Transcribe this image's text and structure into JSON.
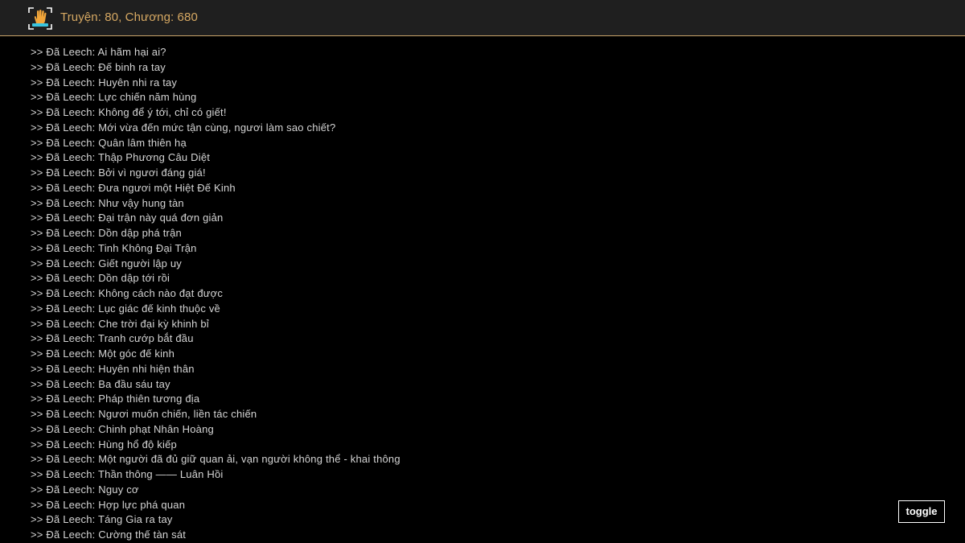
{
  "header": {
    "logo_icon": "hand-scanner-icon",
    "title": "Truyện: 80, Chương: 680"
  },
  "log": {
    "lines": [
      ">> Đã Leech: Ai hãm hại ai?",
      ">> Đã Leech: Đế binh ra tay",
      ">> Đã Leech: Huyên nhi ra tay",
      ">> Đã Leech: Lực chiến năm hùng",
      ">> Đã Leech: Không để ý tới, chỉ có giết!",
      ">> Đã Leech: Mới vừa đến mức tận cùng, ngươi làm sao chiết?",
      ">> Đã Leech: Quân lâm thiên hạ",
      ">> Đã Leech: Thập Phương Câu Diệt",
      ">> Đã Leech: Bởi vì ngươi đáng giá!",
      ">> Đã Leech: Đưa ngươi một Hiệt Đế Kinh",
      ">> Đã Leech: Như vậy hung tàn",
      ">> Đã Leech: Đại trận này quá đơn giản",
      ">> Đã Leech: Dồn dập phá trận",
      ">> Đã Leech: Tinh Không Đại Trận",
      ">> Đã Leech: Giết người lập uy",
      ">> Đã Leech: Dồn dập tới rồi",
      ">> Đã Leech: Không cách nào đạt được",
      ">> Đã Leech: Lục giác đế kinh thuộc về",
      ">> Đã Leech: Che trời đại kỳ khinh bỉ",
      ">> Đã Leech: Tranh cướp bắt đầu",
      ">> Đã Leech: Một góc đế kinh",
      ">> Đã Leech: Huyên nhi hiện thân",
      ">> Đã Leech: Ba đầu sáu tay",
      ">> Đã Leech: Pháp thiên tương địa",
      ">> Đã Leech: Ngươi muốn chiến, liền tác chiến",
      ">> Đã Leech: Chinh phạt Nhân Hoàng",
      ">> Đã Leech: Hùng hổ độ kiếp",
      ">> Đã Leech: Một người đã đủ giữ quan ải, vạn người không thể - khai thông",
      ">> Đã Leech: Thần thông —— Luân Hồi",
      ">> Đã Leech: Nguy cơ",
      ">> Đã Leech: Hợp lực phá quan",
      ">> Đã Leech: Táng Gia ra tay",
      ">> Đã Leech: Cường thế tàn sát"
    ]
  },
  "toggle": {
    "label": "toggle"
  },
  "colors": {
    "background": "#000000",
    "header_bg": "#1f1f1f",
    "accent": "#d7a963",
    "text": "#d4d4d4"
  }
}
